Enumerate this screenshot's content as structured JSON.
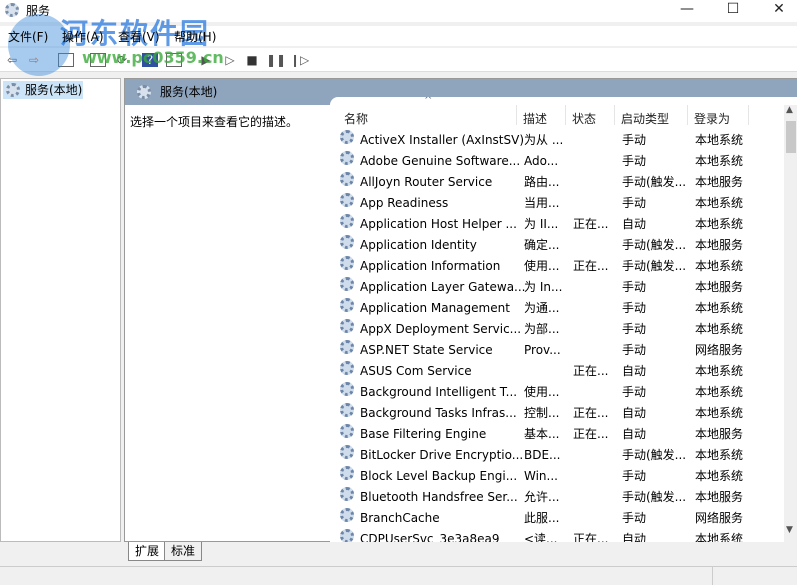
{
  "window": {
    "title": "服务",
    "controls": [
      "—",
      "☐",
      "✕"
    ]
  },
  "watermark": {
    "text": "河东软件园",
    "url": "www.pc0359.cn"
  },
  "menu": [
    "文件(F)",
    "操作(A)",
    "查看(V)",
    "帮助(H)"
  ],
  "toolbar": [
    "back",
    "forward",
    "show-hide-tree",
    "properties",
    "refresh",
    "export",
    "help",
    "view",
    "start",
    "start-alt",
    "stop",
    "pause",
    "resume"
  ],
  "tree": {
    "selected": "服务(本地)"
  },
  "panel": {
    "header": "服务(本地)",
    "description": "选择一个项目来查看它的描述。"
  },
  "columns": [
    "名称",
    "描述",
    "状态",
    "启动类型",
    "登录为"
  ],
  "rows": [
    [
      "ActiveX Installer (AxInstSV)",
      "为从 ...",
      "",
      "手动",
      "本地系统"
    ],
    [
      "Adobe Genuine Software...",
      "Ado...",
      "",
      "手动",
      "本地系统"
    ],
    [
      "AllJoyn Router Service",
      "路由...",
      "",
      "手动(触发...",
      "本地服务"
    ],
    [
      "App Readiness",
      "当用...",
      "",
      "手动",
      "本地系统"
    ],
    [
      "Application Host Helper ...",
      "为 II...",
      "正在...",
      "自动",
      "本地系统"
    ],
    [
      "Application Identity",
      "确定...",
      "",
      "手动(触发...",
      "本地服务"
    ],
    [
      "Application Information",
      "使用...",
      "正在...",
      "手动(触发...",
      "本地系统"
    ],
    [
      "Application Layer Gatewa...",
      "为 In...",
      "",
      "手动",
      "本地服务"
    ],
    [
      "Application Management",
      "为通...",
      "",
      "手动",
      "本地系统"
    ],
    [
      "AppX Deployment Servic...",
      "为部...",
      "",
      "手动",
      "本地系统"
    ],
    [
      "ASP.NET State Service",
      "Prov...",
      "",
      "手动",
      "网络服务"
    ],
    [
      "ASUS Com Service",
      "",
      "正在...",
      "自动",
      "本地系统"
    ],
    [
      "Background Intelligent T...",
      "使用...",
      "",
      "手动",
      "本地系统"
    ],
    [
      "Background Tasks Infras...",
      "控制...",
      "正在...",
      "自动",
      "本地系统"
    ],
    [
      "Base Filtering Engine",
      "基本...",
      "正在...",
      "自动",
      "本地服务"
    ],
    [
      "BitLocker Drive Encryptio...",
      "BDE...",
      "",
      "手动(触发...",
      "本地系统"
    ],
    [
      "Block Level Backup Engi...",
      "Win...",
      "",
      "手动",
      "本地系统"
    ],
    [
      "Bluetooth Handsfree Ser...",
      "允许...",
      "",
      "手动(触发...",
      "本地服务"
    ],
    [
      "BranchCache",
      "此服...",
      "",
      "手动",
      "网络服务"
    ],
    [
      "CDPUserSvc_3e3a8ea9",
      "<读...",
      "正在...",
      "自动",
      "本地系统"
    ]
  ],
  "tabs": [
    "扩展",
    "标准"
  ]
}
